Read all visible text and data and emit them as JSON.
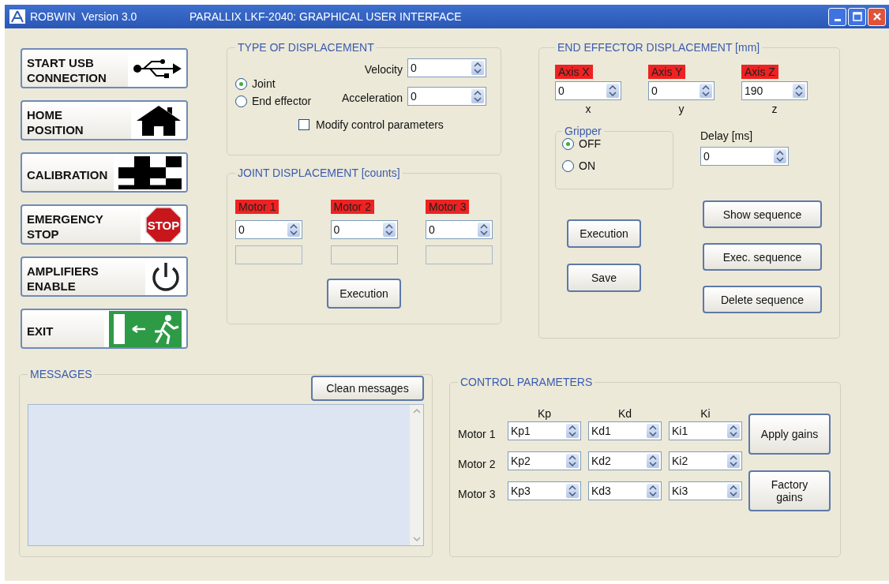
{
  "window": {
    "app": "ROBWIN  Version 3.0",
    "title": "PARALLIX LKF-2040: GRAPHICAL USER INTERFACE"
  },
  "command_buttons": [
    {
      "label": "START USB\nCONNECTION",
      "kind": "usb"
    },
    {
      "label": "HOME\nPOSITION",
      "kind": "home"
    },
    {
      "label": "CALIBRATION",
      "kind": "checker"
    },
    {
      "label": "EMERGENCY\nSTOP",
      "kind": "stop",
      "sign_text": "STOP"
    },
    {
      "label": "AMPLIFIERS\nENABLE",
      "kind": "power"
    },
    {
      "label": "EXIT",
      "kind": "exit"
    }
  ],
  "type_of_displacement": {
    "title": "TYPE OF DISPLACEMENT",
    "modes": [
      {
        "label": "Joint",
        "selected": true
      },
      {
        "label": "End effector",
        "selected": false
      }
    ],
    "fields": [
      {
        "label": "Velocity",
        "value": "0"
      },
      {
        "label": "Acceleration",
        "value": "0"
      }
    ],
    "checkbox": {
      "label": "Modify control parameters",
      "checked": false
    }
  },
  "joint_displacement": {
    "title": "JOINT DISPLACEMENT [counts]",
    "motors": [
      {
        "label": "Motor 1",
        "value": "0"
      },
      {
        "label": "Motor 2",
        "value": "0"
      },
      {
        "label": "Motor 3",
        "value": "0"
      }
    ],
    "button": "Execution"
  },
  "end_effector_displacement": {
    "title": "END EFFECTOR DISPLACEMENT [mm]",
    "axes": [
      {
        "label": "Axis X",
        "value": "0",
        "caption": "x"
      },
      {
        "label": "Axis Y",
        "value": "0",
        "caption": "y"
      },
      {
        "label": "Axis Z",
        "value": "190",
        "caption": "z"
      }
    ],
    "gripper": {
      "title": "Gripper",
      "options": [
        {
          "label": "OFF",
          "selected": true
        },
        {
          "label": "ON",
          "selected": false
        }
      ]
    },
    "delay": {
      "label": "Delay [ms]",
      "value": "0"
    },
    "buttons_left": [
      "Execution",
      "Save"
    ],
    "buttons_right": [
      "Show sequence",
      "Exec. sequence",
      "Delete sequence"
    ]
  },
  "messages": {
    "title": "MESSAGES",
    "button": "Clean messages"
  },
  "control_parameters": {
    "title": "CONTROL PARAMETERS",
    "columns": [
      "Kp",
      "Kd",
      "Ki"
    ],
    "rows": [
      {
        "label": "Motor 1",
        "values": [
          "Kp1",
          "Kd1",
          "Ki1"
        ]
      },
      {
        "label": "Motor 2",
        "values": [
          "Kp2",
          "Kd2",
          "Ki2"
        ]
      },
      {
        "label": "Motor 3",
        "values": [
          "Kp3",
          "Kd3",
          "Ki3"
        ]
      }
    ],
    "buttons": [
      "Apply gains",
      "Factory gains"
    ]
  }
}
